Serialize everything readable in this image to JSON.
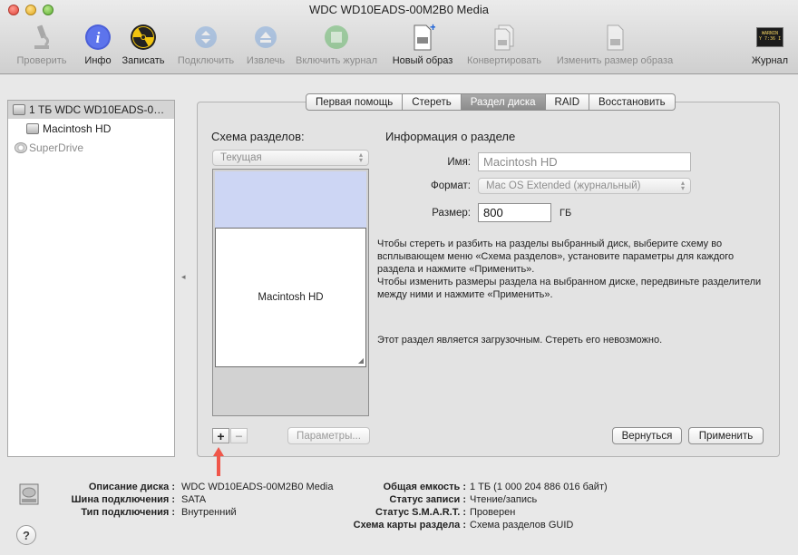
{
  "window": {
    "title": "WDC WD10EADS-00M2B0 Media"
  },
  "toolbar": {
    "verify": "Проверить",
    "info": "Инфо",
    "burn": "Записать",
    "mount": "Подключить",
    "eject": "Извлечь",
    "journal": "Включить журнал",
    "new_image": "Новый образ",
    "convert": "Конвертировать",
    "resize_image": "Изменить размер образа",
    "log": "Журнал",
    "log_icon_text": "WARNIN\nY 7:36 I"
  },
  "sidebar": {
    "items": [
      {
        "label": "1 ТБ WDC WD10EADS-0…"
      },
      {
        "label": "Macintosh HD"
      },
      {
        "label": "SuperDrive"
      }
    ]
  },
  "tabs": [
    "Первая помощь",
    "Стереть",
    "Раздел диска",
    "RAID",
    "Восстановить"
  ],
  "partition": {
    "scheme_title": "Схема разделов:",
    "layout_value": "Текущая",
    "partition_label": "Macintosh HD",
    "add": "+",
    "remove": "−",
    "options_button": "Параметры..."
  },
  "info": {
    "title": "Информация о разделе",
    "name_label": "Имя:",
    "name_value": "Macintosh HD",
    "format_label": "Формат:",
    "format_value": "Mac OS Extended (журнальный)",
    "size_label": "Размер:",
    "size_value": "800",
    "size_unit": "ГБ",
    "description": "Чтобы стереть и разбить на разделы выбранный диск, выберите схему во всплывающем меню «Схема разделов», установите параметры для каждого раздела и нажмите «Применить».\nЧтобы изменить размеры раздела на выбранном диске, передвиньте разделители между ними и нажмите «Применить».",
    "boot_note": "Этот раздел является загрузочным. Стереть его невозможно.",
    "revert": "Вернуться",
    "apply": "Применить"
  },
  "details": {
    "disk_desc_label": "Описание диска :",
    "disk_desc_value": "WDC WD10EADS-00M2B0 Media",
    "bus_label": "Шина подключения :",
    "bus_value": "SATA",
    "conn_label": "Тип подключения :",
    "conn_value": "Внутренний",
    "capacity_label": "Общая емкость :",
    "capacity_value": "1 ТБ (1 000 204 886 016 байт)",
    "write_label": "Статус записи :",
    "write_value": "Чтение/запись",
    "smart_label": "Статус S.M.A.R.T. :",
    "smart_value": "Проверен",
    "map_label": "Схема карты раздела :",
    "map_value": "Схема разделов GUID"
  },
  "colors": {
    "free_space": "#cdd6f4",
    "active_tab": "#8c8c8c",
    "arrow": "#f0564a"
  }
}
